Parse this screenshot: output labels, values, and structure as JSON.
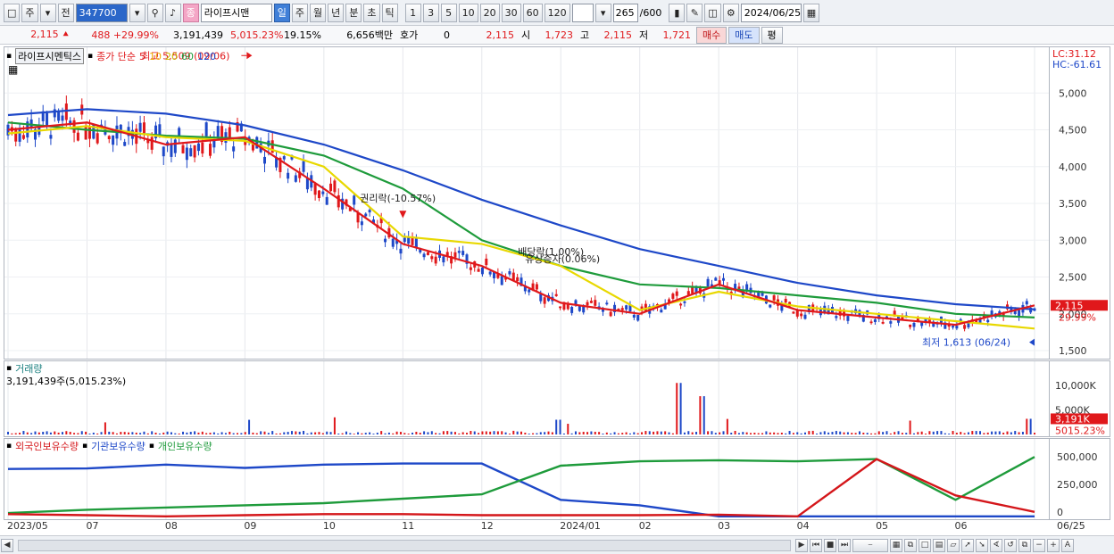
{
  "toolbar": {
    "tab_main": "주",
    "tab_prev": "전",
    "code": "347700",
    "name_badge": "종",
    "stock_name": "라이프시맨",
    "periods": [
      "일",
      "주",
      "월",
      "년",
      "분",
      "초",
      "틱"
    ],
    "intervals": [
      "1",
      "3",
      "5",
      "10",
      "20",
      "30",
      "60",
      "120"
    ],
    "count": "265",
    "count_total": "/600",
    "date": "2024/06/25"
  },
  "quote": {
    "price": "2,115",
    "change": "488",
    "change_pct": "+29.99%",
    "volume": "3,191,439",
    "vol_pct": "5,015.23%",
    "turnover": "19.15%",
    "amount": "6,656백만",
    "hoga_label": "호가",
    "hoga": "0",
    "current": "2,115",
    "open_label": "시",
    "open": "1,723",
    "high_label": "고",
    "high": "2,115",
    "low_label": "저",
    "low": "1,721",
    "buy": "매수",
    "sell": "매도",
    "eval": "평"
  },
  "price_panel": {
    "legend_name": "라이프시멘틱스",
    "legend_ma_label": "종가 단순",
    "ma": [
      {
        "period": "5",
        "color": "#e0181b"
      },
      {
        "period": "10",
        "color": "#f0a800"
      },
      {
        "period": "20",
        "color": "#e8d800"
      },
      {
        "period": "60",
        "color": "#1e9b3b"
      },
      {
        "period": "120",
        "color": "#1e48c8"
      }
    ],
    "lc": "LC:31.12",
    "hc": "HC:-61.61",
    "high_note": "최고 5,509 (09/06)",
    "low_note": "최저 1,613 (06/24)",
    "event_1": "권리락(-10.57%)",
    "event_2": "배당락(1.00%)",
    "event_3": "유상증자(0.06%)",
    "price_tag": "2,115",
    "pct_tag": "29.99%",
    "axis_labels": [
      "5,000",
      "4,500",
      "4,000",
      "3,500",
      "3,000",
      "2,500",
      "2,000",
      "1,500"
    ]
  },
  "volume_panel": {
    "title": "거래량",
    "value": "3,191,439주(5,015.23%)",
    "axis_labels": [
      "10,000K",
      "5,000K"
    ],
    "vol_tag": "3,191K",
    "pct_tag": "5015.23%"
  },
  "holding_panel": {
    "s1": "외국인보유수량",
    "s2": "기관보유수량",
    "s3": "개인보유수량",
    "axis_labels": [
      "500,000",
      "250,000",
      "0"
    ]
  },
  "x_axis": [
    "2023/05",
    "07",
    "08",
    "09",
    "10",
    "11",
    "12",
    "2024/01",
    "02",
    "03",
    "04",
    "05",
    "06",
    "06/25"
  ],
  "chart_data": {
    "type": "line",
    "title": "",
    "x": [
      "2023/05",
      "07",
      "08",
      "09",
      "10",
      "11",
      "12",
      "2024/01",
      "02",
      "03",
      "04",
      "05",
      "06",
      "06/25"
    ],
    "series": [
      {
        "name": "120",
        "values": [
          4700,
          4780,
          4720,
          4560,
          4300,
          3950,
          3550,
          3200,
          2880,
          2650,
          2420,
          2250,
          2130,
          2060
        ]
      },
      {
        "name": "60",
        "values": [
          4600,
          4500,
          4420,
          4380,
          4150,
          3700,
          3000,
          2650,
          2400,
          2350,
          2250,
          2150,
          2000,
          1950
        ]
      },
      {
        "name": "20",
        "values": [
          4450,
          4550,
          4400,
          4350,
          4000,
          3050,
          2950,
          2650,
          2050,
          2300,
          2100,
          2000,
          1900,
          1800
        ]
      },
      {
        "name": "5",
        "values": [
          4500,
          4600,
          4300,
          4400,
          3700,
          2950,
          2650,
          2150,
          2000,
          2400,
          2050,
          1950,
          1850,
          2115
        ]
      }
    ],
    "ylim": [
      1500,
      5500
    ],
    "high": {
      "value": 5509,
      "date": "09/06"
    },
    "low": {
      "value": 1613,
      "date": "06/24"
    }
  }
}
